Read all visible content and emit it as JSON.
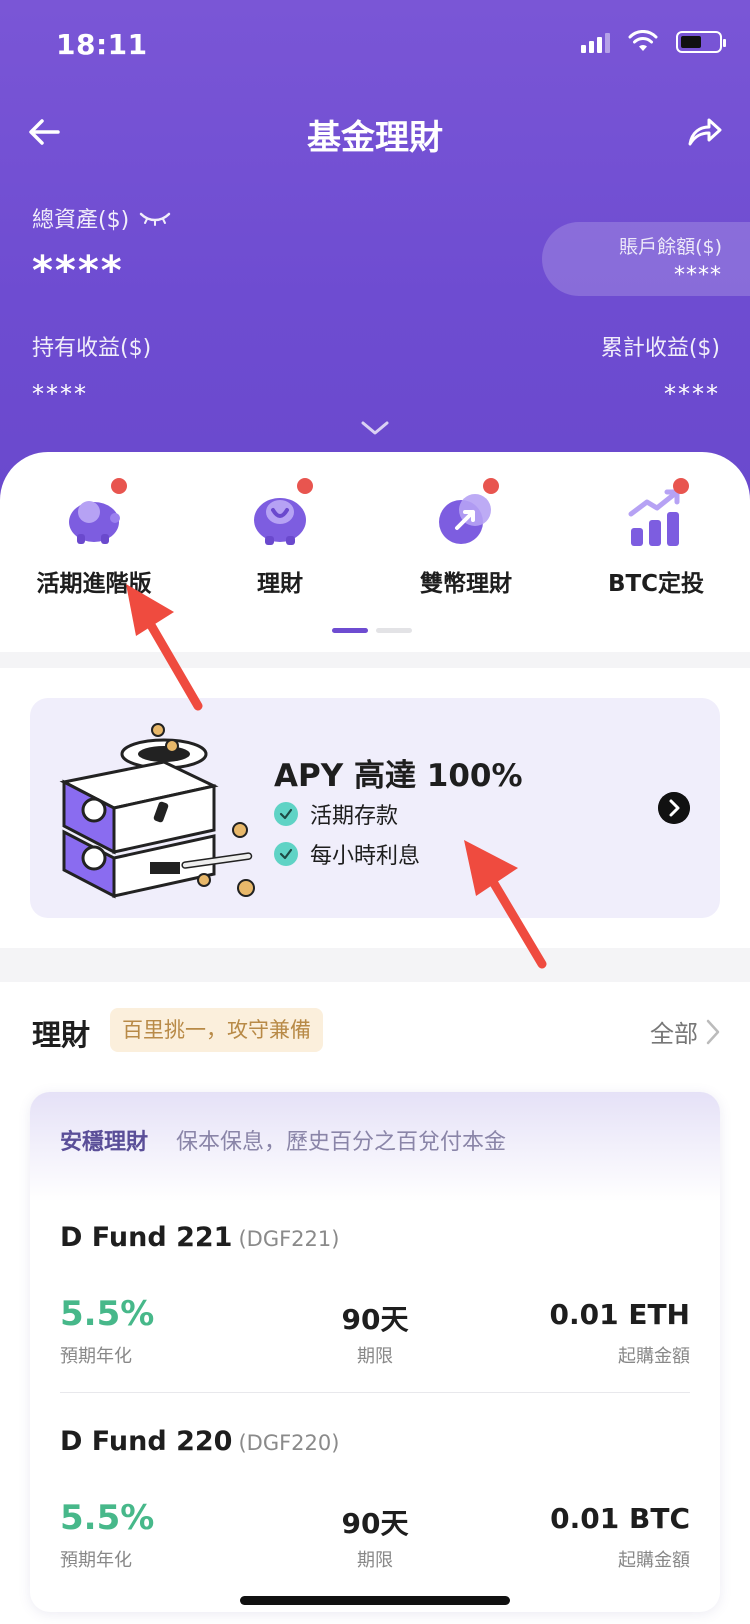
{
  "status": {
    "time": "18:11"
  },
  "nav": {
    "title": "基金理財"
  },
  "assets": {
    "total_label": "總資產($)",
    "total_value": "****",
    "balance_label": "賬戶餘額($)",
    "balance_value": "****",
    "hold_label": "持有收益($)",
    "hold_value": "****",
    "cum_label": "累計收益($)",
    "cum_value": "****"
  },
  "menu": {
    "items": [
      {
        "label": "活期進階版",
        "icon": "piggy-bank-icon"
      },
      {
        "label": "理財",
        "icon": "finance-icon"
      },
      {
        "label": "雙幣理財",
        "icon": "dual-currency-icon"
      },
      {
        "label": "BTC定投",
        "icon": "chart-growth-icon"
      }
    ]
  },
  "promo": {
    "headline": "APY 高達 100%",
    "checks": [
      "活期存款",
      "每小時利息"
    ]
  },
  "section": {
    "title": "理財",
    "tag": "百里挑一，攻守兼備",
    "all_label": "全部"
  },
  "fund_card": {
    "category": "安穩理財",
    "description": "保本保息，歷史百分之百兌付本金",
    "funds": [
      {
        "name": "D Fund 221",
        "code": "(DGF221)",
        "rate": "5.5%",
        "rate_label": "預期年化",
        "term": "90天",
        "term_label": "期限",
        "min": "0.01 ETH",
        "min_label": "起購金額"
      },
      {
        "name": "D Fund 220",
        "code": "(DGF220)",
        "rate": "5.5%",
        "rate_label": "預期年化",
        "term": "90天",
        "term_label": "期限",
        "min": "0.01 BTC",
        "min_label": "起購金額"
      }
    ]
  },
  "colors": {
    "brand": "#6e4cd1",
    "positive": "#47b88a",
    "badge": "#e8554f"
  }
}
